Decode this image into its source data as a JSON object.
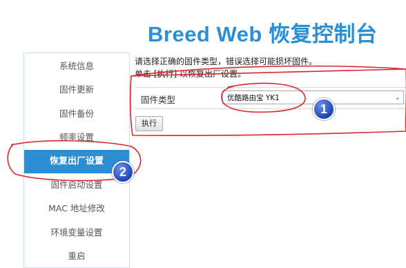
{
  "header": {
    "title": "Breed Web 恢复控制台"
  },
  "sidebar": {
    "items": [
      {
        "label": "系统信息",
        "active": false
      },
      {
        "label": "固件更新",
        "active": false
      },
      {
        "label": "固件备份",
        "active": false
      },
      {
        "label": "频率设置",
        "active": false
      },
      {
        "label": "恢复出厂设置",
        "active": true
      },
      {
        "label": "固件启动设置",
        "active": false
      },
      {
        "label": "MAC 地址修改",
        "active": false
      },
      {
        "label": "环境变量设置",
        "active": false
      },
      {
        "label": "重启",
        "active": false
      }
    ]
  },
  "main": {
    "notice_line1": "请选择正确的固件类型，错误选择可能损坏固件。",
    "notice_line2": "单击 [执行] 以恢复出厂设置。",
    "firmware_label": "固件类型",
    "firmware_selected": "优酷路由宝 YK1",
    "execute_button": "执行"
  },
  "annotations": {
    "marker1": "1",
    "marker2": "2",
    "color": "#d9262c"
  },
  "colors": {
    "accent": "#2b8fd6",
    "active_bg": "#2b8fd6"
  }
}
